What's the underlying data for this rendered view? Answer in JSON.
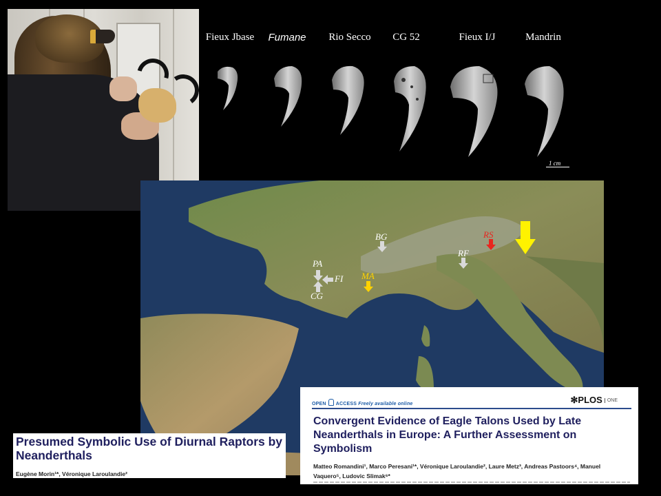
{
  "talon_specimens": [
    {
      "label": "Fieux Jbase"
    },
    {
      "label": "Fumane"
    },
    {
      "label": "Rio Secco"
    },
    {
      "label": "CG 52"
    },
    {
      "label": "Fieux I/J"
    },
    {
      "label": "Mandrin"
    }
  ],
  "scale_label": "1 cm",
  "map": {
    "sites": [
      {
        "code": "PA",
        "color": "#d9d9d9"
      },
      {
        "code": "FI",
        "color": "#d9d9d9"
      },
      {
        "code": "CG",
        "color": "#d9d9d9"
      },
      {
        "code": "MA",
        "color": "#ffd200"
      },
      {
        "code": "BG",
        "color": "#d9d9d9"
      },
      {
        "code": "RF",
        "color": "#d9d9d9"
      },
      {
        "code": "RS",
        "color": "#e8261f"
      }
    ],
    "highlight_arrow_color": "#fff200"
  },
  "paper1": {
    "title": "Presumed Symbolic Use of Diurnal Raptors by Neanderthals",
    "authors": "Eugène Morin¹*, Véronique Laroulandie²"
  },
  "paper2": {
    "open_access_prefix": "OPEN",
    "open_access_suffix": "ACCESS",
    "freely_available": "Freely available online",
    "journal": "PLOS",
    "journal_suffix": "ONE",
    "title": "Convergent Evidence of Eagle Talons Used by Late Neanderthals in Europe: A Further Assessment on Symbolism",
    "authors": "Matteo Romandini¹, Marco Peresani¹*, Véronique Laroulandie², Laure Metz³, Andreas Pastoors⁴, Manuel Vaquero⁵, Ludovic Slimak⁶*"
  },
  "colors": {
    "background": "#000000",
    "title_navy": "#1f1f5e",
    "plos_blue": "#1a5aa6"
  }
}
